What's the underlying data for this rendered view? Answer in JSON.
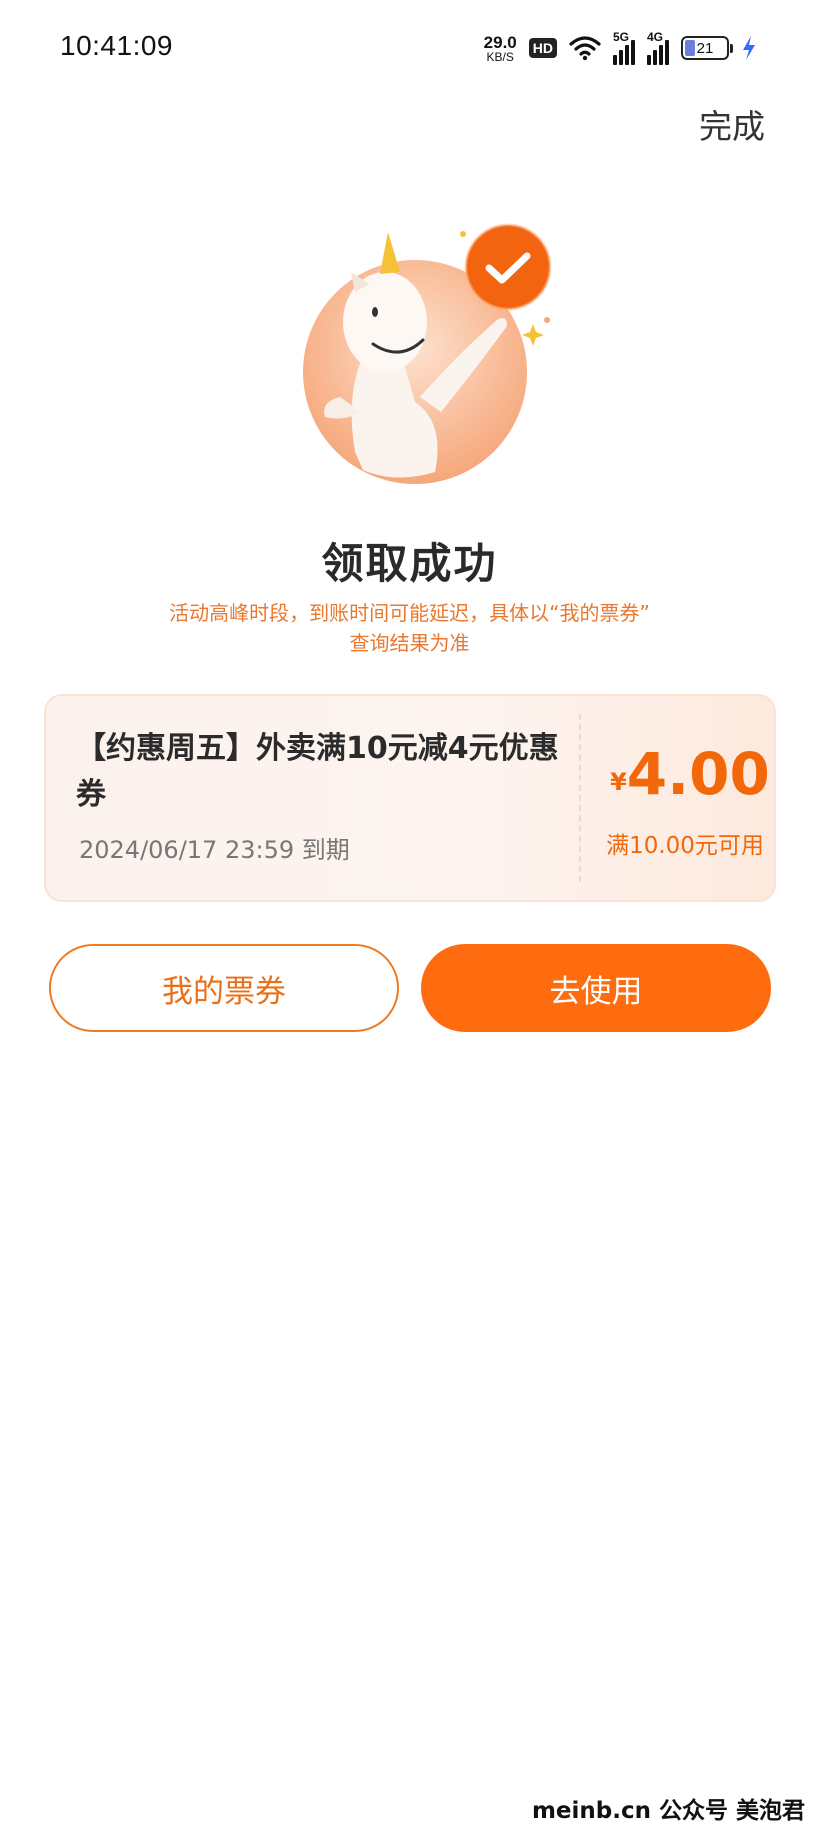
{
  "status_bar": {
    "time": "10:41:09",
    "net_speed_value": "29.0",
    "net_speed_unit": "KB/S",
    "hd_badge": "HD",
    "sig1_label": "5G",
    "sig2_label": "4G",
    "battery_level": "21",
    "icons": [
      "wifi-icon",
      "signal-5g-icon",
      "signal-4g-icon",
      "battery-icon",
      "charging-bolt-icon"
    ]
  },
  "header": {
    "done_label": "完成"
  },
  "result": {
    "title": "领取成功",
    "note_line1": "活动高峰时段，到账时间可能延迟，具体以“我的票券”",
    "note_line2": "查询结果为准"
  },
  "coupon": {
    "title": "【约惠周五】外卖满10元减4元优惠券",
    "expiry": "2024/06/17 23:59 到期",
    "currency": "¥",
    "amount": "4.00",
    "condition": "满10.00元可用"
  },
  "actions": {
    "my_tickets_label": "我的票券",
    "use_label": "去使用"
  },
  "watermark": "meinb.cn  公众号 美泡君",
  "colors": {
    "accent": "#ff6b0f",
    "note": "#e9782e",
    "coupon_bg": "#fdf4ef"
  }
}
